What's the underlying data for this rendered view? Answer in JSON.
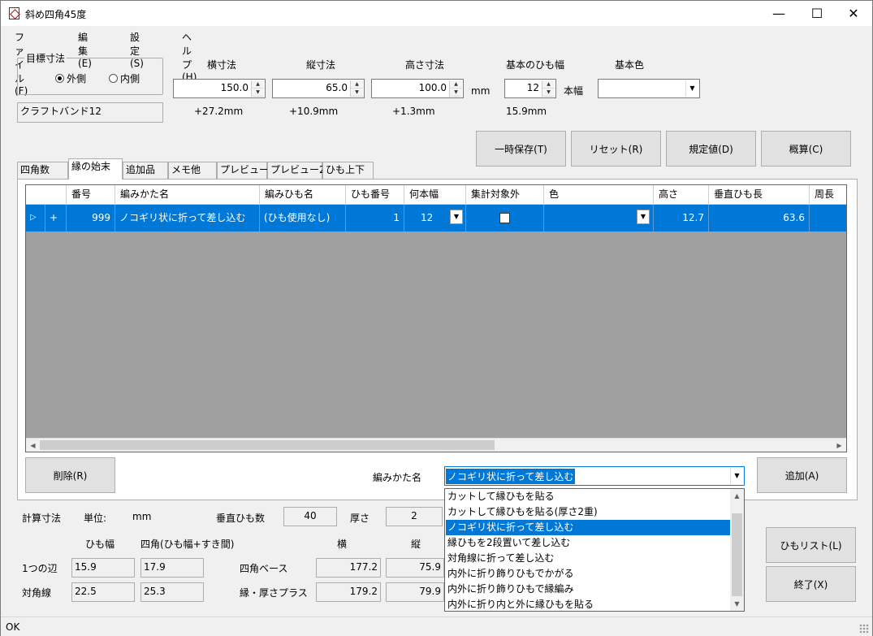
{
  "window": {
    "title": "斜め四角45度",
    "minimize": "—",
    "maximize": "☐",
    "close": "✕"
  },
  "menu": [
    "ファイル(F)",
    "編集(E)",
    "設定(S)",
    "ヘルプ(H)"
  ],
  "target": {
    "group_title": "目標寸法",
    "outer": "外側",
    "inner": "内側",
    "selected": "外側",
    "name_value": "クラフトバンド12"
  },
  "dims": {
    "width_label": "横寸法",
    "width_value": "150.0",
    "width_plus": "+27.2mm",
    "length_label": "縦寸法",
    "length_value": "65.0",
    "length_plus": "+10.9mm",
    "height_label": "高さ寸法",
    "height_value": "100.0",
    "height_plus": "+1.3mm",
    "unit": "mm",
    "band_label": "基本のひも幅",
    "band_value": "12",
    "band_unit": "本幅",
    "band_mm": "15.9mm",
    "color_label": "基本色",
    "color_value": ""
  },
  "actions": {
    "temp_save": "一時保存(T)",
    "reset": "リセット(R)",
    "defaults": "規定値(D)",
    "estimate": "概算(C)"
  },
  "tabs": [
    "四角数",
    "縁の始末",
    "追加品",
    "メモ他",
    "プレビュー",
    "プレビュー2",
    "ひも上下"
  ],
  "active_tab": "縁の始末",
  "grid": {
    "headers": [
      "",
      "番号",
      "編みかた名",
      "編みひも名",
      "ひも番号",
      "何本幅",
      "集計対象外",
      "色",
      "高さ",
      "垂直ひも長",
      "周長"
    ],
    "row": {
      "marker": "▷",
      "plus": "+",
      "number": "999",
      "method": "ノコギリ状に折って差し込む",
      "band_name": "(ひも使用なし)",
      "band_no": "1",
      "width": "12",
      "excluded": false,
      "color": "",
      "height": "12.7",
      "vertical_len": "63.6",
      "perimeter": ""
    }
  },
  "edit": {
    "delete": "削除(R)",
    "method_label": "編みかた名",
    "method_value": "ノコギリ状に折って差し込む",
    "add": "追加(A)",
    "options": [
      "カットして縁ひもを貼る",
      "カットして縁ひもを貼る(厚さ2重)",
      "ノコギリ状に折って差し込む",
      "縁ひもを2段置いて差し込む",
      "対角線に折って差し込む",
      "内外に折り飾りひもでかがる",
      "内外に折り飾りひもで縁編み",
      "内外に折り内と外に縁ひもを貼る"
    ],
    "selected_option": "ノコギリ状に折って差し込む"
  },
  "calc": {
    "label": "計算寸法",
    "unit_label": "単位:",
    "unit_value": "mm",
    "vertical_count_label": "垂直ひも数",
    "vertical_count": "40",
    "thickness_label": "厚さ",
    "thickness": "2",
    "col_band": "ひも幅",
    "col_square": "四角(ひも幅+すき間)",
    "col_w": "横",
    "col_l": "縦",
    "row1_label": "1つの辺",
    "row1_band": "15.9",
    "row1_square": "17.9",
    "row2_label": "対角線",
    "row2_band": "22.5",
    "row2_square": "25.3",
    "base_label": "四角ベース",
    "base_w": "177.2",
    "base_l": "75.9",
    "edge_label": "縁・厚さプラス",
    "edge_w": "179.2",
    "edge_l": "79.9"
  },
  "side": {
    "band_list": "ひもリスト(L)",
    "finish": "終了(X)"
  },
  "status": "OK"
}
